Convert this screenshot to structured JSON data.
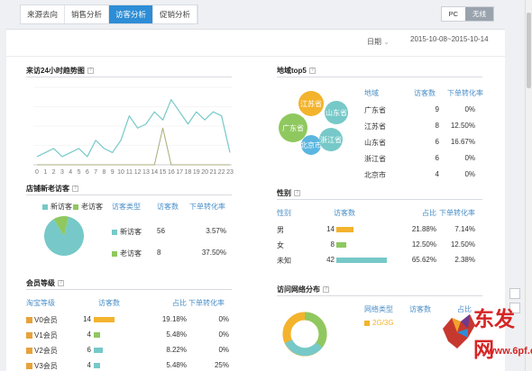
{
  "tabs": [
    "来源去向",
    "销售分析",
    "访客分析",
    "促销分析"
  ],
  "active_tab": 2,
  "device": {
    "pc": "PC",
    "wireless": "无线"
  },
  "date": {
    "label": "日期",
    "value": "2015-10-08~2015-10-14"
  },
  "colors": {
    "accent": "#2d8dd6",
    "teal": "#76c9c8",
    "green": "#8fc85f",
    "yellow": "#f3b32d",
    "blue": "#5ab6e0",
    "grey": "#bbb"
  },
  "trend": {
    "title": "来访24小时趋势图",
    "chart_data": {
      "type": "line",
      "categories": [
        "0",
        "1",
        "2",
        "3",
        "4",
        "5",
        "6",
        "7",
        "8",
        "9",
        "10",
        "11",
        "12",
        "13",
        "14",
        "15",
        "16",
        "17",
        "18",
        "19",
        "20",
        "21",
        "22",
        "23"
      ],
      "series": [
        {
          "values": [
            2,
            3,
            4,
            2,
            3,
            4,
            2,
            6,
            4,
            3,
            6,
            12,
            9,
            10,
            13,
            11,
            16,
            13,
            10,
            13,
            11,
            13,
            12,
            3
          ]
        },
        {
          "values": [
            0,
            0,
            0,
            0,
            0,
            0,
            0,
            0,
            0,
            0,
            0,
            0,
            0,
            0,
            0,
            9,
            0,
            0,
            0,
            0,
            0,
            0,
            0,
            0
          ]
        }
      ],
      "ylim": [
        0,
        19
      ]
    }
  },
  "newold": {
    "title": "店铺新老访客",
    "legend": [
      "新访客",
      "老访客"
    ],
    "headers": [
      "访客类型",
      "访客数",
      "下单转化率"
    ],
    "rows": [
      {
        "type": "新访客",
        "count": "56",
        "rate": "3.57%"
      },
      {
        "type": "老访客",
        "count": "8",
        "rate": "37.50%"
      }
    ],
    "chart_data": {
      "type": "pie",
      "categories": [
        "新访客",
        "老访客"
      ],
      "values": [
        56,
        8
      ]
    }
  },
  "members": {
    "title": "会员等级",
    "headers": [
      "淘宝等级",
      "访客数",
      "占比",
      "下单转化率"
    ],
    "rows": [
      {
        "level": "V0会员",
        "count": "14",
        "pct": "19.18%",
        "rate": "0%",
        "val": 14
      },
      {
        "level": "V1会员",
        "count": "4",
        "pct": "5.48%",
        "rate": "0%",
        "val": 4
      },
      {
        "level": "V2会员",
        "count": "6",
        "pct": "8.22%",
        "rate": "0%",
        "val": 6
      },
      {
        "level": "V3会员",
        "count": "4",
        "pct": "5.48%",
        "rate": "25%",
        "val": 4
      }
    ]
  },
  "region": {
    "title": "地域top5",
    "headers": [
      "地域",
      "访客数",
      "下单转化率"
    ],
    "rows": [
      {
        "name": "广东省",
        "count": "9",
        "rate": "0%"
      },
      {
        "name": "江苏省",
        "count": "8",
        "rate": "12.50%"
      },
      {
        "name": "山东省",
        "count": "6",
        "rate": "16.67%"
      },
      {
        "name": "浙江省",
        "count": "6",
        "rate": "0%"
      },
      {
        "name": "北京市",
        "count": "4",
        "rate": "0%"
      }
    ],
    "bubbles": [
      "江苏省",
      "山东省",
      "广东省",
      "北京市",
      "浙江省"
    ]
  },
  "gender": {
    "title": "性别",
    "headers": [
      "性别",
      "访客数",
      "占比",
      "下单转化率"
    ],
    "rows": [
      {
        "g": "男",
        "count": "14",
        "pct": "21.88%",
        "rate": "7.14%",
        "val": 14
      },
      {
        "g": "女",
        "count": "8",
        "pct": "12.50%",
        "rate": "12.50%",
        "val": 8
      },
      {
        "g": "未知",
        "count": "42",
        "pct": "65.62%",
        "rate": "2.38%",
        "val": 42
      }
    ]
  },
  "network": {
    "title": "访问网络分布",
    "headers": [
      "网络类型",
      "访客数",
      "占比"
    ],
    "rows": [
      {
        "type": "2G/3G"
      }
    ]
  },
  "watermark": {
    "text": "东发网",
    "sub": "www.6pf.cn"
  }
}
